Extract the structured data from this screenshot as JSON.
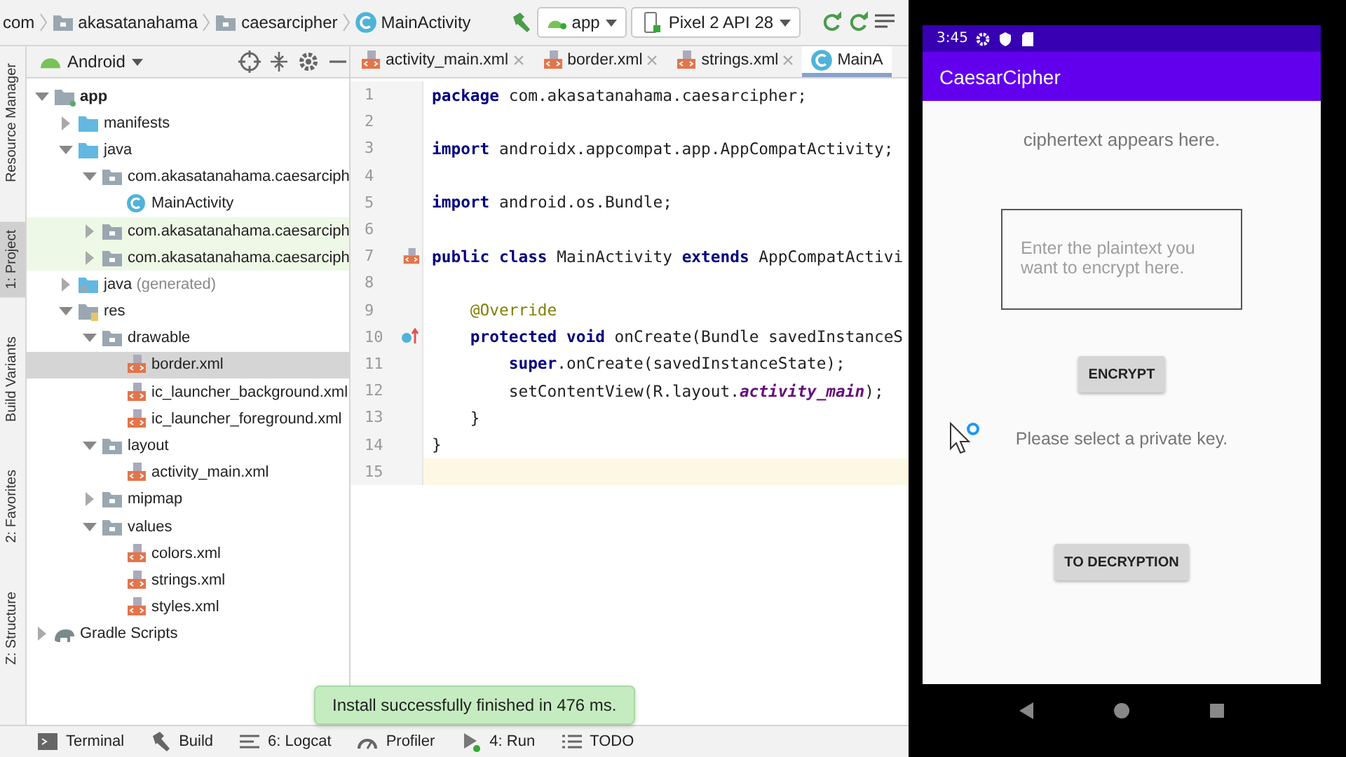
{
  "breadcrumbs": [
    {
      "label": "com",
      "kind": "folder"
    },
    {
      "label": "akasatanahama",
      "kind": "folder"
    },
    {
      "label": "caesarcipher",
      "kind": "folder"
    },
    {
      "label": "MainActivity",
      "kind": "class"
    }
  ],
  "run_config": {
    "label": "app"
  },
  "device": {
    "label": "Pixel 2 API 28"
  },
  "side_tabs": [
    {
      "label": "Resource Manager",
      "selected": false
    },
    {
      "label": "1: Project",
      "selected": true
    },
    {
      "label": "Build Variants",
      "selected": false
    },
    {
      "label": "2: Favorites",
      "selected": false
    },
    {
      "label": "Z: Structure",
      "selected": false
    }
  ],
  "project": {
    "view": "Android",
    "tree": [
      {
        "label": "app",
        "kind": "module",
        "expanded": true,
        "selected": false,
        "highlighted": false,
        "children": [
          {
            "label": "manifests",
            "kind": "folder",
            "expanded": false,
            "selected": false,
            "highlighted": false
          },
          {
            "label": "java",
            "kind": "folder",
            "expanded": true,
            "selected": false,
            "highlighted": false,
            "children": [
              {
                "label": "com.akasatanahama.caesarciph",
                "kind": "package",
                "expanded": true,
                "selected": false,
                "highlighted": false,
                "children": [
                  {
                    "label": "MainActivity",
                    "kind": "class",
                    "selected": false,
                    "highlighted": false
                  }
                ]
              },
              {
                "label": "com.akasatanahama.caesarciph",
                "kind": "package",
                "expanded": false,
                "selected": false,
                "highlighted": true
              },
              {
                "label": "com.akasatanahama.caesarciph",
                "kind": "package",
                "expanded": false,
                "selected": false,
                "highlighted": true
              }
            ]
          },
          {
            "label": "java",
            "note": "(generated)",
            "kind": "genfolder",
            "expanded": false,
            "selected": false,
            "highlighted": false
          },
          {
            "label": "res",
            "kind": "resfolder",
            "expanded": true,
            "selected": false,
            "highlighted": false,
            "children": [
              {
                "label": "drawable",
                "kind": "package",
                "expanded": true,
                "selected": false,
                "highlighted": false,
                "children": [
                  {
                    "label": "border.xml",
                    "kind": "xml",
                    "selected": true,
                    "highlighted": false
                  },
                  {
                    "label": "ic_launcher_background.xml",
                    "kind": "xml",
                    "selected": false,
                    "highlighted": false
                  },
                  {
                    "label": "ic_launcher_foreground.xml",
                    "kind": "xml",
                    "selected": false,
                    "highlighted": false
                  }
                ]
              },
              {
                "label": "layout",
                "kind": "package",
                "expanded": true,
                "selected": false,
                "highlighted": false,
                "children": [
                  {
                    "label": "activity_main.xml",
                    "kind": "xml",
                    "selected": false,
                    "highlighted": false
                  }
                ]
              },
              {
                "label": "mipmap",
                "kind": "package",
                "expanded": false,
                "selected": false,
                "highlighted": false
              },
              {
                "label": "values",
                "kind": "package",
                "expanded": true,
                "selected": false,
                "highlighted": false,
                "children": [
                  {
                    "label": "colors.xml",
                    "kind": "xml",
                    "selected": false,
                    "highlighted": false
                  },
                  {
                    "label": "strings.xml",
                    "kind": "xml",
                    "selected": false,
                    "highlighted": false
                  },
                  {
                    "label": "styles.xml",
                    "kind": "xml",
                    "selected": false,
                    "highlighted": false
                  }
                ]
              }
            ]
          }
        ]
      },
      {
        "label": "Gradle Scripts",
        "kind": "gradle",
        "expanded": false,
        "selected": false,
        "highlighted": false
      }
    ]
  },
  "editor_tabs": [
    {
      "label": "activity_main.xml",
      "kind": "xml",
      "selected": false
    },
    {
      "label": "border.xml",
      "kind": "xml",
      "selected": false
    },
    {
      "label": "strings.xml",
      "kind": "xml",
      "selected": false
    },
    {
      "label": "MainA",
      "kind": "class",
      "selected": true
    }
  ],
  "code": [
    {
      "number": "1",
      "current": false,
      "tokens": [
        {
          "kind": "keyword",
          "text": "package"
        },
        {
          "kind": "plain",
          "text": " com.akasatanahama.caesarcipher;"
        }
      ]
    },
    {
      "number": "2",
      "current": false
    },
    {
      "number": "3",
      "current": false,
      "tokens": [
        {
          "kind": "keyword",
          "text": "import"
        },
        {
          "kind": "plain",
          "text": " androidx.appcompat.app.AppCompatActivity;"
        }
      ]
    },
    {
      "number": "4",
      "current": false
    },
    {
      "number": "5",
      "current": false,
      "tokens": [
        {
          "kind": "keyword",
          "text": "import"
        },
        {
          "kind": "plain",
          "text": " android.os.Bundle;"
        }
      ]
    },
    {
      "number": "6",
      "current": false
    },
    {
      "number": "7",
      "current": false,
      "gutter": {
        "kind": "xml"
      },
      "tokens": [
        {
          "kind": "keyword",
          "text": "public class"
        },
        {
          "kind": "plain",
          "text": " MainActivity "
        },
        {
          "kind": "keyword",
          "text": "extends"
        },
        {
          "kind": "plain",
          "text": " AppCompatActivi"
        }
      ]
    },
    {
      "number": "8",
      "current": false
    },
    {
      "number": "9",
      "current": false,
      "tokens": [
        {
          "kind": "annotation",
          "text": "    @Override"
        }
      ]
    },
    {
      "number": "10",
      "current": false,
      "gutter": {
        "kind": "override"
      },
      "tokens": [
        {
          "kind": "keyword",
          "text": "    protected void"
        },
        {
          "kind": "plain",
          "text": " onCreate(Bundle savedInstanceS"
        }
      ]
    },
    {
      "number": "11",
      "current": false,
      "tokens": [
        {
          "kind": "keyword",
          "text": "        super"
        },
        {
          "kind": "plain",
          "text": ".onCreate(savedInstanceState);"
        }
      ]
    },
    {
      "number": "12",
      "current": false,
      "tokens": [
        {
          "kind": "plain",
          "text": "        setContentView(R.layout."
        },
        {
          "kind": "static",
          "text": "activity_main"
        },
        {
          "kind": "plain",
          "text": ");"
        }
      ]
    },
    {
      "number": "13",
      "current": false,
      "tokens": [
        {
          "kind": "plain",
          "text": "    }"
        }
      ]
    },
    {
      "number": "14",
      "current": false,
      "tokens": [
        {
          "kind": "plain",
          "text": "}"
        }
      ]
    },
    {
      "number": "15",
      "current": true
    }
  ],
  "toast": {
    "text": "Install successfully finished in 476 ms."
  },
  "bottom_tools": [
    {
      "label": "Terminal",
      "kind": "terminal"
    },
    {
      "label": "Build",
      "kind": "build"
    },
    {
      "label": "6: Logcat",
      "kind": "logcat"
    },
    {
      "label": "Profiler",
      "kind": "profiler"
    },
    {
      "label": "4: Run",
      "kind": "run"
    },
    {
      "label": "TODO",
      "kind": "todo"
    }
  ],
  "phone": {
    "time": "3:45",
    "app_title": "CaesarCipher",
    "output_text": "ciphertext appears here.",
    "input": {
      "placeholder": "Enter the plaintext you want to encrypt here."
    },
    "encrypt_button": "ENCRYPT",
    "key_prompt": "Please select a private key.",
    "decrypt_button": "TO DECRYPTION"
  }
}
